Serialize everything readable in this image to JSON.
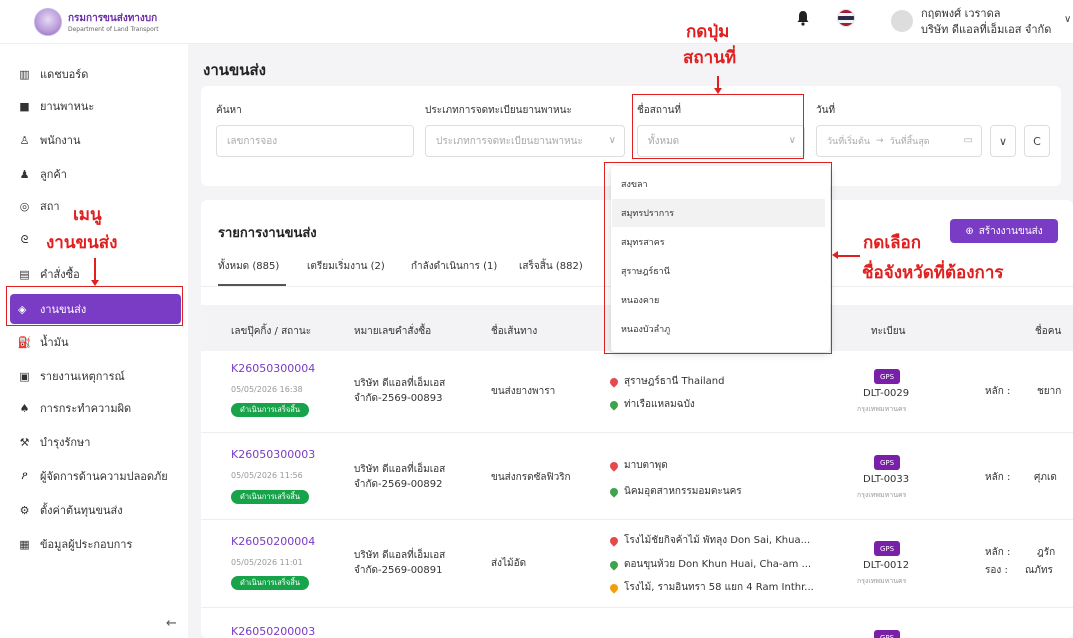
{
  "header": {
    "logo_title": "กรมการขนส่งทางบก",
    "logo_subtitle": "Department of Land Transport",
    "user_name": "กฤตพงศ์ เวราดล",
    "user_company": "บริษัท ดีแอลที่เอ็มเอส จำกัด",
    "flag_colors": [
      "#a51931",
      "#f4f5f8",
      "#2d2a4a",
      "#f4f5f8",
      "#a51931"
    ]
  },
  "sidebar": {
    "items": [
      {
        "label": "แดชบอร์ด",
        "icon": "chart-icon"
      },
      {
        "label": "ยานพาหนะ",
        "icon": "truck-icon"
      },
      {
        "label": "พนักงาน",
        "icon": "user-icon"
      },
      {
        "label": "ลูกค้า",
        "icon": "users-icon"
      },
      {
        "label": "สถา",
        "icon": "location-icon"
      },
      {
        "label": "",
        "icon": "route-icon"
      },
      {
        "label": "คำสั่งซื้อ",
        "icon": "clipboard-icon"
      },
      {
        "label": "งานขนส่ง",
        "icon": "box-icon"
      },
      {
        "label": "น้ำมัน",
        "icon": "fuel-icon"
      },
      {
        "label": "รายงานเหตุการณ์",
        "icon": "report-icon"
      },
      {
        "label": "การกระทำความผิด",
        "icon": "violation-icon"
      },
      {
        "label": "บำรุงรักษา",
        "icon": "wrench-icon"
      },
      {
        "label": "ผู้จัดการด้านความปลอดภัย",
        "icon": "safety-icon"
      },
      {
        "label": "ตั้งค่าต้นทุนขนส่ง",
        "icon": "settings-icon"
      },
      {
        "label": "ข้อมูลผู้ประกอบการ",
        "icon": "building-icon"
      }
    ],
    "collapse": "←"
  },
  "page": {
    "title": "งานขนส่ง"
  },
  "filters": {
    "search_label": "ค้นหา",
    "search_placeholder": "เลขการจอง",
    "reg_type_label": "ประเภทการจดทะเบียนยานพาหนะ",
    "reg_type_placeholder": "ประเภทการจดทะเบียนยานพาหนะ",
    "place_label": "ชื่อสถานที่",
    "place_value": "ทั้งหมด",
    "date_label": "วันที่",
    "date_start": "วันที่เริ่มต้น",
    "date_arrow": "→",
    "date_end": "วันที่สิ้นสุด",
    "expand_icon": "∨",
    "refresh_icon": "C"
  },
  "dropdown": {
    "options": [
      "สงขลา",
      "สมุทรปราการ",
      "สมุทรสาคร",
      "สุราษฎร์ธานี",
      "หนองคาย",
      "หนองบัวลำภู"
    ]
  },
  "list": {
    "title": "รายการงานขนส่ง",
    "create_button": "สร้างงานขนส่ง",
    "tabs": [
      "ทั้งหมด (885)",
      "เตรียมเริ่มงาน (2)",
      "กำลังดำเนินการ (1)",
      "เสร็จสิ้น (882)"
    ],
    "columns": [
      "เลขปุ๊คกิ้ง / สถานะ",
      "หมายเลขคำสั่งซื้อ",
      "ชื่อเส้นทาง",
      "ทะเบียน",
      "ชื่อคน"
    ],
    "rows": [
      {
        "id": "K26050300004",
        "date": "05/05/2026 16:38",
        "status": "ดำเนินการเสร็จสิ้น",
        "order_1": "บริษัท ดีแอลที่เอ็มเอส",
        "order_2": "จำกัด-2569-00893",
        "route": "ขนส่งยางพารา",
        "locations": [
          "สุราษฎร์ธานี Thailand",
          "ท่าเรือแหลมฉบัง"
        ],
        "gps": "GPS",
        "plate": "DLT-0029",
        "province": "กรุงเทพมหานคร",
        "driver_role": "หลัก :",
        "driver_name": "ชยาก"
      },
      {
        "id": "K26050300003",
        "date": "05/05/2026 11:56",
        "status": "ดำเนินการเสร็จสิ้น",
        "order_1": "บริษัท ดีแอลที่เอ็มเอส",
        "order_2": "จำกัด-2569-00892",
        "route": "ขนส่งกรดซัลฟิวริก",
        "locations": [
          "มาบตาพุด",
          "นิคมอุตสาหกรรมอมตะนคร"
        ],
        "gps": "GPS",
        "plate": "DLT-0033",
        "province": "กรุงเทพมหานคร",
        "driver_role": "หลัก :",
        "driver_name": "ศุภเด"
      },
      {
        "id": "K26050200004",
        "date": "05/05/2026 11:01",
        "status": "ดำเนินการเสร็จสิ้น",
        "order_1": "บริษัท ดีแอลที่เอ็มเอส",
        "order_2": "จำกัด-2569-00891",
        "route": "ส่งไม้อัด",
        "locations": [
          "โรงไม้ชัยกิจค้าไม้ พัทลุง Don Sai, Khua...",
          "ดอนขุนห้วย Don Khun Huai, Cha-am ...",
          "โรงไม้, รามอินทรา 58 แยก 4 Ram Inthr..."
        ],
        "gps": "GPS",
        "plate": "DLT-0012",
        "province": "กรุงเทพมหานคร",
        "driver_role": "หลัก :",
        "driver_name": "ฎรัก",
        "driver_role2": "รอง :",
        "driver_name2": "ณภัทร"
      },
      {
        "id": "K26050200003",
        "gps": "GPS"
      }
    ]
  },
  "annotations": {
    "click_place_1": "กดปุ่ม",
    "click_place_2": "สถานที่",
    "menu_1": "เมนู",
    "menu_2": "งานขนส่ง",
    "select_1": "กดเลือก",
    "select_2": "ชื่อจังหวัดที่ต้องการ"
  },
  "colors": {
    "brand_purple": "#7a3cc4",
    "status_green": "#16a34a",
    "annotation_red": "#e02020",
    "pin_red": "#e5484d",
    "pin_green": "#3fa34d",
    "pin_orange": "#f59e0b"
  }
}
